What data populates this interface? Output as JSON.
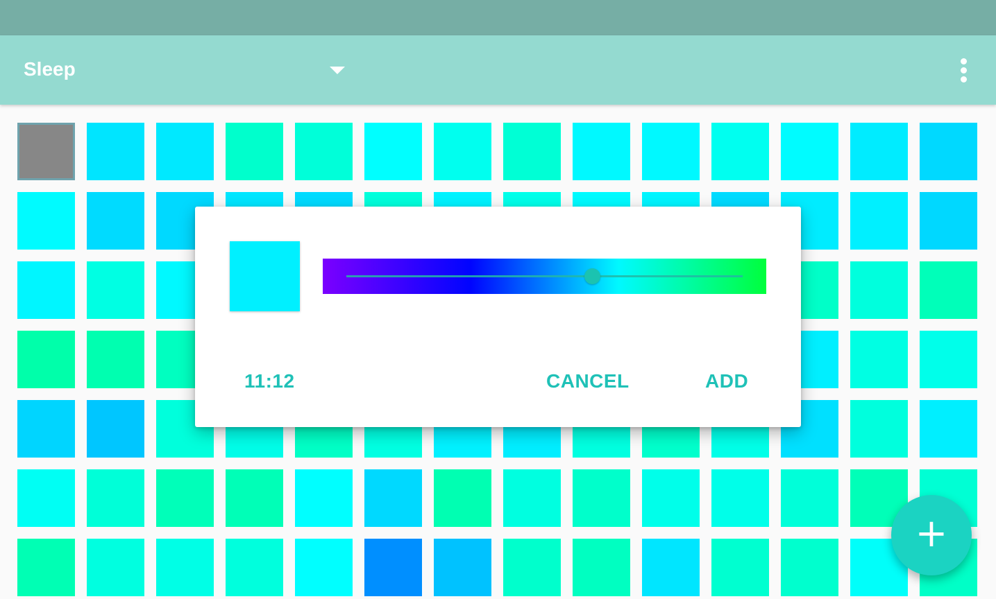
{
  "app_bar": {
    "spinner": {
      "selected": "Sleep"
    },
    "overflow_icon": "more-vert-icon"
  },
  "grid": {
    "columns": 14,
    "cells": [
      "#878787",
      "#00e5ff",
      "#00e9ff",
      "#00ffcc",
      "#00ffd9",
      "#00ffff",
      "#00ffef",
      "#00ffd5",
      "#00f9ff",
      "#00f9ff",
      "#00fff0",
      "#00fcff",
      "#00ecff",
      "#00d9ff",
      "#00fbff",
      "#00dbff",
      "#00d9ff",
      "#00e6ff",
      "#00dbff",
      "#00ffdc",
      "#00f3ff",
      "#00ffea",
      "#00fbff",
      "#00f5ff",
      "#00dbff",
      "#00ecff",
      "#00f0ff",
      "#00d8ff",
      "#00f6ff",
      "#00ffe3",
      "#00f9ff",
      "#00ffd5",
      "#00ffd0",
      "#00ffe5",
      "#00fde8",
      "#00ffee",
      "#00fbff",
      "#00ffdf",
      "#00ffd8",
      "#00ffc8",
      "#00ffdd",
      "#00ffb9",
      "#00ffaa",
      "#00ffb0",
      "#00ffc0",
      "#00fef2",
      "#00f0ff",
      "#00e8ff",
      "#00f1ff",
      "#00ffe5",
      "#00ffea",
      "#00ffe6",
      "#00ffdf",
      "#00efff",
      "#00ffe3",
      "#00ffea",
      "#00d5ff",
      "#00c6ff",
      "#00ffdc",
      "#00fde8",
      "#00ffc6",
      "#00ffe2",
      "#00f1ff",
      "#00eeff",
      "#00ffe0",
      "#00ffcc",
      "#00ffe8",
      "#00e0ff",
      "#00ffdd",
      "#00efff",
      "#00fff4",
      "#00ffd8",
      "#00ffb9",
      "#00ffb7",
      "#00ffff",
      "#00d9ff",
      "#00ffb2",
      "#00ffe0",
      "#00ffcb",
      "#00ffea",
      "#00ffe9",
      "#00ffd9",
      "#00ffb8",
      "#00ffd4",
      "#00ffb4",
      "#00ffe0",
      "#00ffe6",
      "#00ffdd",
      "#00ffff",
      "#008fff",
      "#00c2ff",
      "#00ffcc",
      "#00ffc1",
      "#00e6ff",
      "#00ffd0",
      "#00ffce",
      "#00fffa",
      "#00ffc7"
    ],
    "selected_index": 0
  },
  "dialog": {
    "preview_color": "#00f0ff",
    "slider": {
      "gradient": [
        "#7b00ff",
        "#0004ff",
        "#00f9ff",
        "#00ff3c"
      ],
      "value": 0.62
    },
    "time_button": "11:12",
    "cancel_button": "CANCEL",
    "add_button": "ADD"
  },
  "fab": {
    "icon": "plus-icon",
    "glyph": "+"
  },
  "colors": {
    "status_bar": "#76aea5",
    "app_bar": "#94dad0",
    "accent": "#1fc1b7",
    "fab": "#1bd3c2"
  }
}
